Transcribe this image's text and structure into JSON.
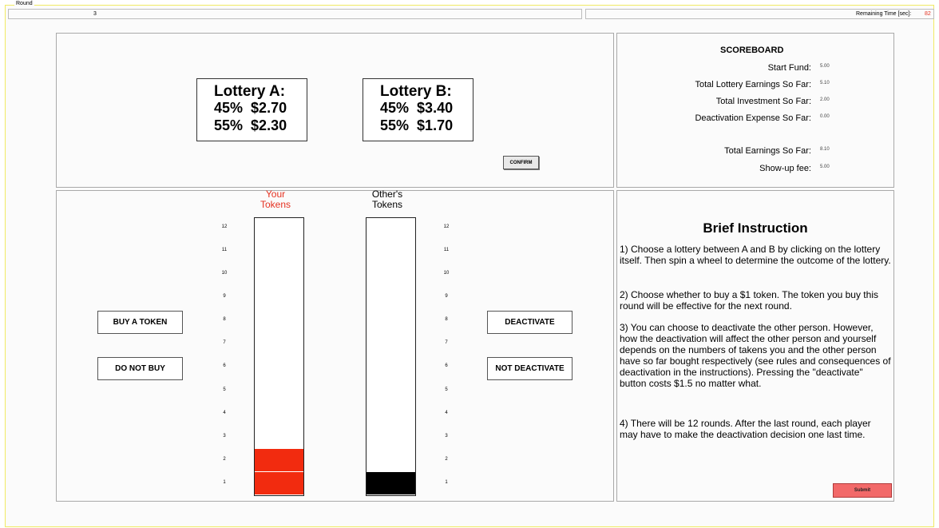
{
  "header": {
    "round_label": "Round",
    "round_value": "3",
    "remaining_label": "Remaining Time [sec]:",
    "remaining_value": "82"
  },
  "lotteries": [
    {
      "title": "Lottery A:",
      "rows": [
        {
          "prob": "45%",
          "amount": "$2.70"
        },
        {
          "prob": "55%",
          "amount": "$2.30"
        }
      ]
    },
    {
      "title": "Lottery B:",
      "rows": [
        {
          "prob": "45%",
          "amount": "$3.40"
        },
        {
          "prob": "55%",
          "amount": "$1.70"
        }
      ]
    }
  ],
  "confirm_label": "CONFIRM",
  "scoreboard": {
    "title": "SCOREBOARD",
    "rows": [
      {
        "label": "Start Fund:",
        "value": "5.00"
      },
      {
        "label": "Total Lottery Earnings So Far:",
        "value": "5.10"
      },
      {
        "label": "Total Investment So Far:",
        "value": "2.00"
      },
      {
        "label": "Deactivation Expense So Far:",
        "value": "0.00"
      },
      {
        "label": "Total Earnings So Far:",
        "value": "8.10"
      },
      {
        "label": "Show-up fee:",
        "value": "5.00"
      }
    ]
  },
  "tokens": {
    "your_label_1": "Your",
    "your_label_2": "Tokens",
    "other_label_1": "Other's",
    "other_label_2": "Tokens",
    "your_count": 2,
    "other_count": 1,
    "max": 12,
    "ticks": [
      "12",
      "11",
      "10",
      "9",
      "8",
      "7",
      "6",
      "5",
      "4",
      "3",
      "2",
      "1"
    ],
    "colors": {
      "yours": "#f22b0f",
      "others": "#000000"
    }
  },
  "buttons": {
    "buy": "BUY A TOKEN",
    "no_buy": "DO NOT BUY",
    "deactivate": "DEACTIVATE",
    "not_deactivate": "NOT DEACTIVATE",
    "submit": "Submit"
  },
  "instructions": {
    "title": "Brief Instruction",
    "paragraphs": [
      "1) Choose a lottery between A and B by clicking on the lottery itself. Then spin a wheel to determine the outcome of the lottery.",
      "2) Choose whether to buy a $1 token. The token you buy this round will be effective for the next round.",
      "3) You can choose to deactivate the other person. However, how the deactivation will affect the other person and yourself depends on the numbers of takens you and the other person have so far bought respectively (see rules and consequences of deactivation in the instructions). Pressing the \"deactivate\" button costs $1.5 no matter what.",
      "4) There will be 12 rounds. After the last round, each player may have to make the deactivation decision one last time."
    ]
  }
}
